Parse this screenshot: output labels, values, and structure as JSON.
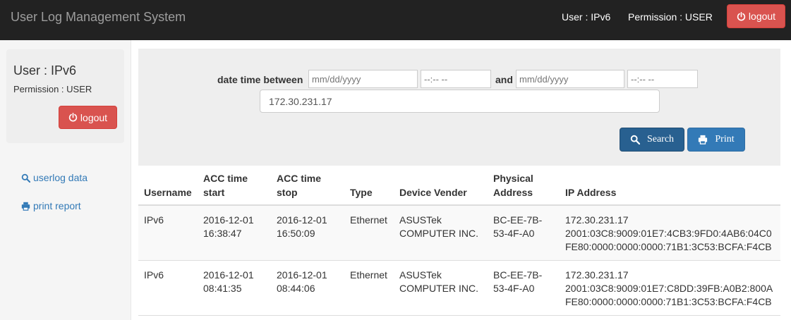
{
  "navbar": {
    "brand": "User Log Management System",
    "user": "User : IPv6",
    "permission": "Permission : USER",
    "logout_label": "logout"
  },
  "sidebar": {
    "user": "User : IPv6",
    "permission": "Permission : USER",
    "logout_label": "logout",
    "links": [
      {
        "label": "userlog data",
        "icon": "search-icon"
      },
      {
        "label": "print report",
        "icon": "print-icon"
      }
    ]
  },
  "search": {
    "between_label": "date time between",
    "and_label": "and",
    "date_placeholder": "mm/dd/yyyy",
    "time_placeholder": "--:-- --",
    "ip_value": "172.30.231.17",
    "search_label": "Search",
    "print_label": "Print"
  },
  "table": {
    "headers": {
      "username": "Username",
      "acc_start": [
        "ACC time",
        "start"
      ],
      "acc_stop": [
        "ACC time",
        "stop"
      ],
      "type": "Type",
      "vender": "Device Vender",
      "physical": [
        "Physical",
        "Address"
      ],
      "ip": "IP Address"
    },
    "rows": [
      {
        "username": "IPv6",
        "start": [
          "2016-12-01",
          "16:38:47"
        ],
        "stop": [
          "2016-12-01",
          "16:50:09"
        ],
        "type": "Ethernet",
        "vender": [
          "ASUSTek",
          "COMPUTER INC."
        ],
        "physical": [
          "BC-EE-7B-",
          "53-4F-A0"
        ],
        "ip": [
          "172.30.231.17",
          "2001:03C8:9009:01E7:4CB3:9FD0:4AB6:04C0",
          "FE80:0000:0000:0000:71B1:3C53:BCFA:F4CB"
        ]
      },
      {
        "username": "IPv6",
        "start": [
          "2016-12-01",
          "08:41:35"
        ],
        "stop": [
          "2016-12-01",
          "08:44:06"
        ],
        "type": "Ethernet",
        "vender": [
          "ASUSTek",
          "COMPUTER INC."
        ],
        "physical": [
          "BC-EE-7B-",
          "53-4F-A0"
        ],
        "ip": [
          "172.30.231.17",
          "2001:03C8:9009:01E7:C8DD:39FB:A0B2:800A",
          "FE80:0000:0000:0000:71B1:3C53:BCFA:F4CB"
        ]
      }
    ]
  },
  "colors": {
    "navbar_bg": "#222222",
    "danger": "#d9534f",
    "primary": "#337ab7",
    "primary_active": "#286090",
    "link": "#337ab7"
  }
}
